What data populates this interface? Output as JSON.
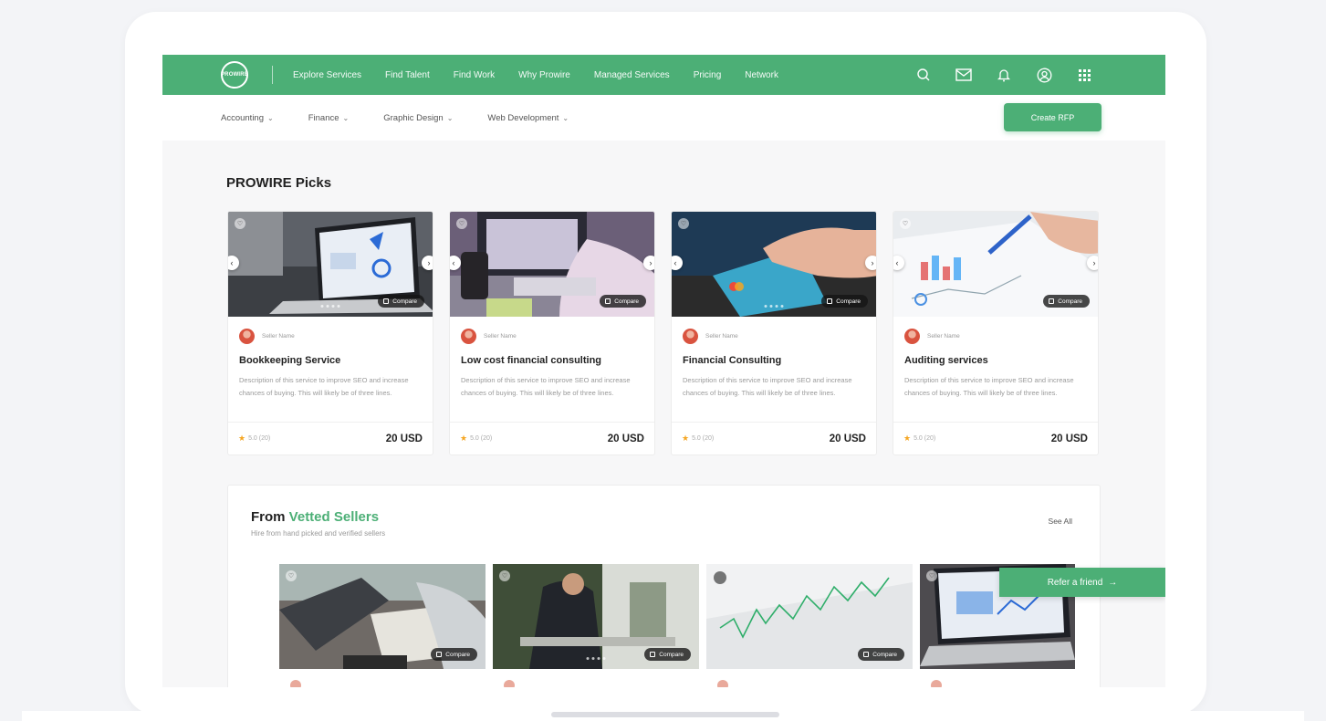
{
  "brand": {
    "logo_text": "PROWIRE"
  },
  "nav": {
    "links": [
      "Explore Services",
      "Find Talent",
      "Find Work",
      "Why Prowire",
      "Managed Services",
      "Pricing",
      "Network"
    ],
    "icons": [
      "search-icon",
      "mail-icon",
      "bell-icon",
      "user-icon",
      "apps-grid-icon"
    ]
  },
  "categories": [
    "Accounting",
    "Finance",
    "Graphic Design",
    "Web Development"
  ],
  "create_rfp_label": "Create RFP",
  "picks": {
    "title": "PROWIRE Picks",
    "cards": [
      {
        "seller": "Seller Name",
        "title": "Bookkeeping Service",
        "description": "Description of this service to improve SEO and increase chances of buying. This will likely be of three lines.",
        "rating": "5.0 (20)",
        "price": "20 USD",
        "compare": "Compare"
      },
      {
        "seller": "Seller Name",
        "title": "Low cost financial consulting",
        "description": "Description of this service to improve SEO and increase chances of buying. This will likely be of three lines.",
        "rating": "5.0 (20)",
        "price": "20 USD",
        "compare": "Compare"
      },
      {
        "seller": "Seller Name",
        "title": "Financial Consulting",
        "description": "Description of this service to improve SEO and increase chances of buying. This will likely be of three lines.",
        "rating": "5.0 (20)",
        "price": "20 USD",
        "compare": "Compare"
      },
      {
        "seller": "Seller Name",
        "title": "Auditing services",
        "description": "Description of this service to improve SEO and increase chances of buying. This will likely be of three lines.",
        "rating": "5.0 (20)",
        "price": "20 USD",
        "compare": "Compare"
      }
    ]
  },
  "vetted": {
    "title_prefix": "From ",
    "title_highlight": "Vetted Sellers",
    "subtitle": "Hire from hand picked and verified sellers",
    "see_all": "See All",
    "compare_label": "Compare"
  },
  "refer": {
    "label": "Refer a friend",
    "arrow": "→"
  },
  "colors": {
    "brand_green": "#4caf76",
    "star": "#f5a623"
  }
}
